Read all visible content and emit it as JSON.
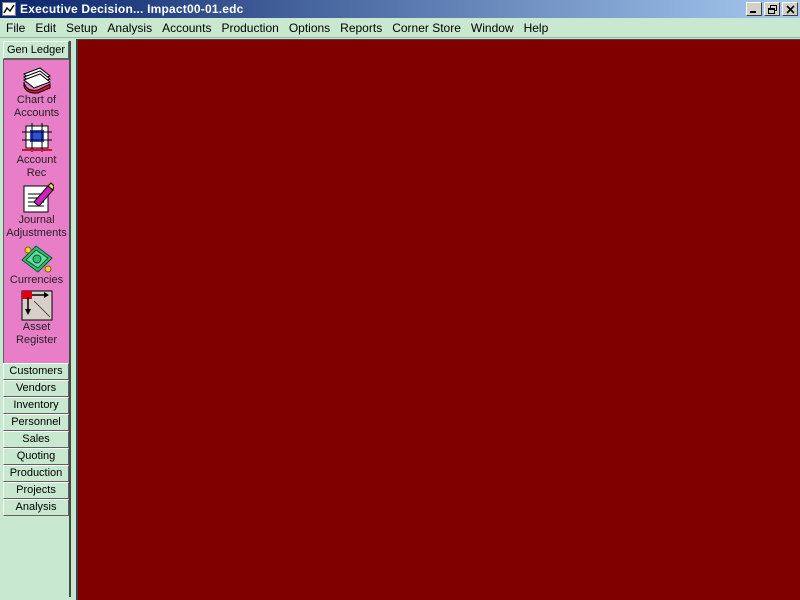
{
  "window": {
    "title": "Executive Decision... Impact00-01.edc",
    "buttons": [
      "minimize",
      "restore",
      "close"
    ]
  },
  "menu": [
    "File",
    "Edit",
    "Setup",
    "Analysis",
    "Accounts",
    "Production",
    "Options",
    "Reports",
    "Corner Store",
    "Window",
    "Help"
  ],
  "sidebar": {
    "active_category": "Gen Ledger",
    "panel_items": [
      {
        "label1": "Chart of",
        "label2": "Accounts",
        "icon": "chart-of-accounts-icon"
      },
      {
        "label1": "Account",
        "label2": "Rec",
        "icon": "account-rec-icon"
      },
      {
        "label1": "Journal",
        "label2": "Adjustments",
        "icon": "journal-adjustments-icon"
      },
      {
        "label1": "Currencies",
        "label2": "",
        "icon": "currencies-icon"
      },
      {
        "label1": "Asset",
        "label2": "Register",
        "icon": "asset-register-icon"
      }
    ],
    "categories": [
      "Customers",
      "Vendors",
      "Inventory",
      "Personnel",
      "Sales",
      "Quoting",
      "Production",
      "Projects",
      "Analysis"
    ]
  },
  "colors": {
    "workspace": "#800000",
    "panel": "#e87ec8",
    "chrome": "#c8e8d0"
  }
}
